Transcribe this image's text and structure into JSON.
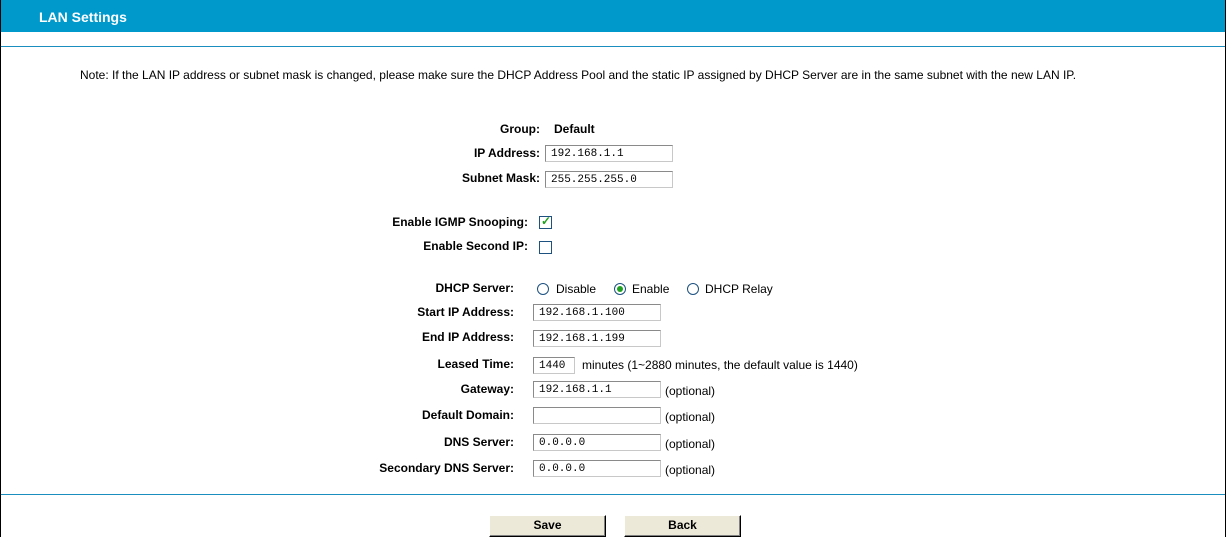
{
  "header": {
    "title": "LAN Settings"
  },
  "note": "Note: If the LAN IP address or subnet mask is changed, please make sure the DHCP Address Pool and the static IP assigned by DHCP Server are in the same subnet with the new LAN IP.",
  "lan": {
    "group_label": "Group:",
    "group_value": "Default",
    "ip_label": "IP Address:",
    "ip_value": "192.168.1.1",
    "mask_label": "Subnet Mask:",
    "mask_value": "255.255.255.0"
  },
  "options": {
    "igmp_label": "Enable IGMP Snooping:",
    "igmp_checked": true,
    "second_ip_label": "Enable Second IP:",
    "second_ip_checked": false
  },
  "dhcp": {
    "server_label": "DHCP Server:",
    "server_options": [
      "Disable",
      "Enable",
      "DHCP Relay"
    ],
    "server_selected": "Enable",
    "start_label": "Start IP Address:",
    "start_value": "192.168.1.100",
    "end_label": "End IP Address:",
    "end_value": "192.168.1.199",
    "lease_label": "Leased Time:",
    "lease_value": "1440",
    "lease_hint": "minutes (1~2880 minutes, the default value is 1440)",
    "gateway_label": "Gateway:",
    "gateway_value": "192.168.1.1",
    "domain_label": "Default Domain:",
    "domain_value": "",
    "dns_label": "DNS Server:",
    "dns_value": "0.0.0.0",
    "dns2_label": "Secondary DNS Server:",
    "dns2_value": "0.0.0.0",
    "optional_text": "(optional)"
  },
  "buttons": {
    "save": "Save",
    "back": "Back"
  },
  "colors": {
    "title_bar": "#0099cc",
    "check": "#21a121"
  }
}
